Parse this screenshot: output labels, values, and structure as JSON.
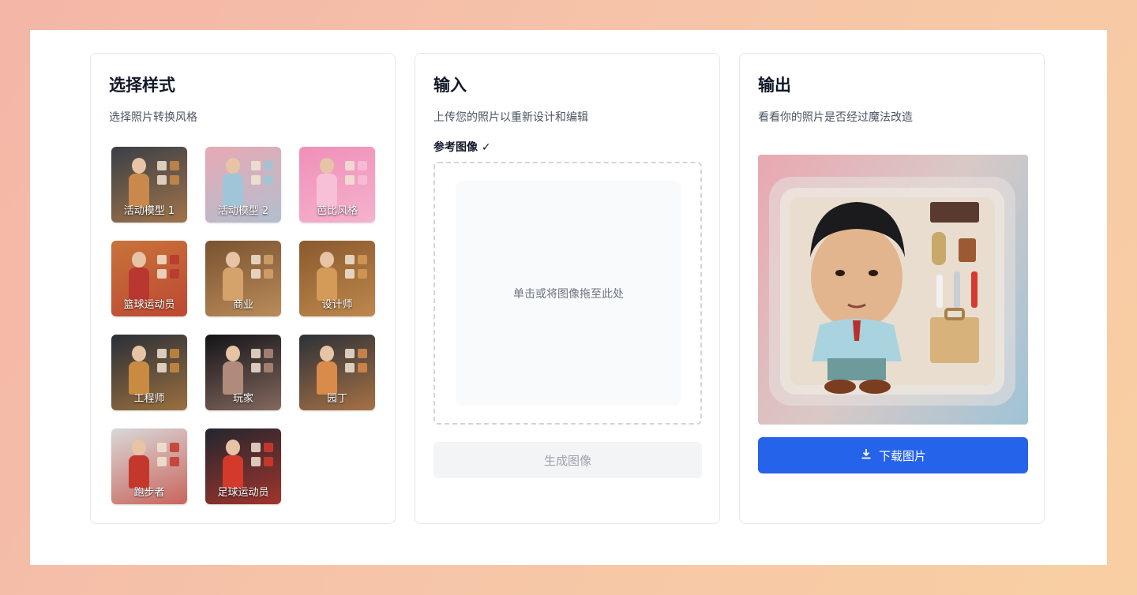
{
  "style_panel": {
    "title": "选择样式",
    "description": "选择照片转换风格",
    "styles": [
      {
        "label": "活动模型 1",
        "bg": "#3a3f48",
        "accent": "#c9894a"
      },
      {
        "label": "活动模型 2",
        "bg": "#e7a9b4",
        "accent": "#9ec6d8"
      },
      {
        "label": "芭比风格",
        "bg": "#f08fb8",
        "accent": "#f7c0d6"
      },
      {
        "label": "篮球运动员",
        "bg": "#c8733a",
        "accent": "#b8372f"
      },
      {
        "label": "商业",
        "bg": "#7a5230",
        "accent": "#d4a36b"
      },
      {
        "label": "设计师",
        "bg": "#8a5a2e",
        "accent": "#d39a58"
      },
      {
        "label": "工程师",
        "bg": "#2a2f38",
        "accent": "#c98a42"
      },
      {
        "label": "玩家",
        "bg": "#141418",
        "accent": "#b08a7a"
      },
      {
        "label": "园丁",
        "bg": "#2c3138",
        "accent": "#d88b4a"
      },
      {
        "label": "跑步者",
        "bg": "#d8d8d8",
        "accent": "#c4372c"
      },
      {
        "label": "足球运动员",
        "bg": "#22262e",
        "accent": "#d43a2c"
      }
    ]
  },
  "input_panel": {
    "title": "输入",
    "description": "上传您的照片以重新设计和编辑",
    "reference_label": "参考图像 ✓",
    "dropzone_text": "单击或将图像拖至此处",
    "generate_label": "生成图像"
  },
  "output_panel": {
    "title": "输出",
    "description": "看看你的照片是否经过魔法改造",
    "download_label": "下载图片",
    "download_icon": "download-icon",
    "accent_color": "#2563eb"
  }
}
